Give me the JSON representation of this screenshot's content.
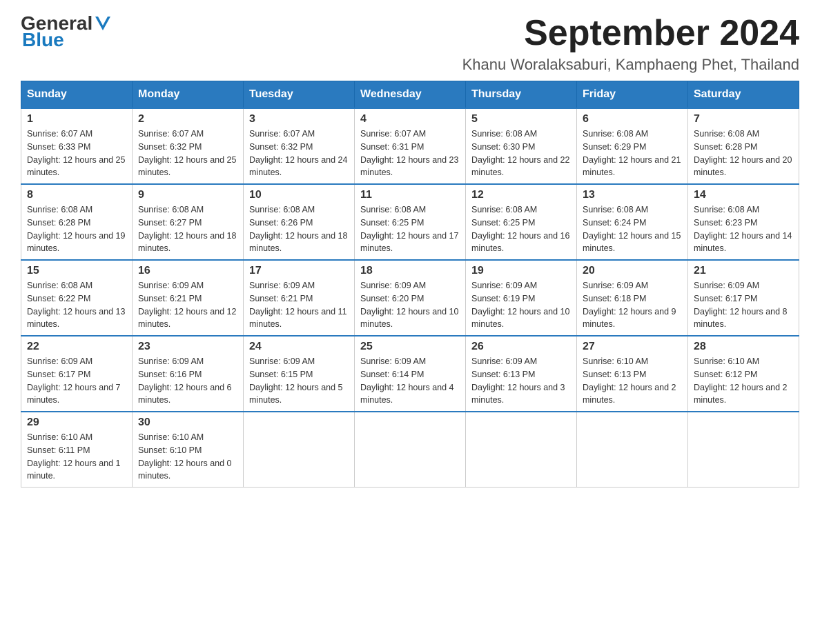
{
  "header": {
    "logo_general": "General",
    "logo_blue": "Blue",
    "month_title": "September 2024",
    "location": "Khanu Woralaksaburi, Kamphaeng Phet, Thailand"
  },
  "days_of_week": [
    "Sunday",
    "Monday",
    "Tuesday",
    "Wednesday",
    "Thursday",
    "Friday",
    "Saturday"
  ],
  "weeks": [
    [
      {
        "day": "1",
        "sunrise": "Sunrise: 6:07 AM",
        "sunset": "Sunset: 6:33 PM",
        "daylight": "Daylight: 12 hours and 25 minutes."
      },
      {
        "day": "2",
        "sunrise": "Sunrise: 6:07 AM",
        "sunset": "Sunset: 6:32 PM",
        "daylight": "Daylight: 12 hours and 25 minutes."
      },
      {
        "day": "3",
        "sunrise": "Sunrise: 6:07 AM",
        "sunset": "Sunset: 6:32 PM",
        "daylight": "Daylight: 12 hours and 24 minutes."
      },
      {
        "day": "4",
        "sunrise": "Sunrise: 6:07 AM",
        "sunset": "Sunset: 6:31 PM",
        "daylight": "Daylight: 12 hours and 23 minutes."
      },
      {
        "day": "5",
        "sunrise": "Sunrise: 6:08 AM",
        "sunset": "Sunset: 6:30 PM",
        "daylight": "Daylight: 12 hours and 22 minutes."
      },
      {
        "day": "6",
        "sunrise": "Sunrise: 6:08 AM",
        "sunset": "Sunset: 6:29 PM",
        "daylight": "Daylight: 12 hours and 21 minutes."
      },
      {
        "day": "7",
        "sunrise": "Sunrise: 6:08 AM",
        "sunset": "Sunset: 6:28 PM",
        "daylight": "Daylight: 12 hours and 20 minutes."
      }
    ],
    [
      {
        "day": "8",
        "sunrise": "Sunrise: 6:08 AM",
        "sunset": "Sunset: 6:28 PM",
        "daylight": "Daylight: 12 hours and 19 minutes."
      },
      {
        "day": "9",
        "sunrise": "Sunrise: 6:08 AM",
        "sunset": "Sunset: 6:27 PM",
        "daylight": "Daylight: 12 hours and 18 minutes."
      },
      {
        "day": "10",
        "sunrise": "Sunrise: 6:08 AM",
        "sunset": "Sunset: 6:26 PM",
        "daylight": "Daylight: 12 hours and 18 minutes."
      },
      {
        "day": "11",
        "sunrise": "Sunrise: 6:08 AM",
        "sunset": "Sunset: 6:25 PM",
        "daylight": "Daylight: 12 hours and 17 minutes."
      },
      {
        "day": "12",
        "sunrise": "Sunrise: 6:08 AM",
        "sunset": "Sunset: 6:25 PM",
        "daylight": "Daylight: 12 hours and 16 minutes."
      },
      {
        "day": "13",
        "sunrise": "Sunrise: 6:08 AM",
        "sunset": "Sunset: 6:24 PM",
        "daylight": "Daylight: 12 hours and 15 minutes."
      },
      {
        "day": "14",
        "sunrise": "Sunrise: 6:08 AM",
        "sunset": "Sunset: 6:23 PM",
        "daylight": "Daylight: 12 hours and 14 minutes."
      }
    ],
    [
      {
        "day": "15",
        "sunrise": "Sunrise: 6:08 AM",
        "sunset": "Sunset: 6:22 PM",
        "daylight": "Daylight: 12 hours and 13 minutes."
      },
      {
        "day": "16",
        "sunrise": "Sunrise: 6:09 AM",
        "sunset": "Sunset: 6:21 PM",
        "daylight": "Daylight: 12 hours and 12 minutes."
      },
      {
        "day": "17",
        "sunrise": "Sunrise: 6:09 AM",
        "sunset": "Sunset: 6:21 PM",
        "daylight": "Daylight: 12 hours and 11 minutes."
      },
      {
        "day": "18",
        "sunrise": "Sunrise: 6:09 AM",
        "sunset": "Sunset: 6:20 PM",
        "daylight": "Daylight: 12 hours and 10 minutes."
      },
      {
        "day": "19",
        "sunrise": "Sunrise: 6:09 AM",
        "sunset": "Sunset: 6:19 PM",
        "daylight": "Daylight: 12 hours and 10 minutes."
      },
      {
        "day": "20",
        "sunrise": "Sunrise: 6:09 AM",
        "sunset": "Sunset: 6:18 PM",
        "daylight": "Daylight: 12 hours and 9 minutes."
      },
      {
        "day": "21",
        "sunrise": "Sunrise: 6:09 AM",
        "sunset": "Sunset: 6:17 PM",
        "daylight": "Daylight: 12 hours and 8 minutes."
      }
    ],
    [
      {
        "day": "22",
        "sunrise": "Sunrise: 6:09 AM",
        "sunset": "Sunset: 6:17 PM",
        "daylight": "Daylight: 12 hours and 7 minutes."
      },
      {
        "day": "23",
        "sunrise": "Sunrise: 6:09 AM",
        "sunset": "Sunset: 6:16 PM",
        "daylight": "Daylight: 12 hours and 6 minutes."
      },
      {
        "day": "24",
        "sunrise": "Sunrise: 6:09 AM",
        "sunset": "Sunset: 6:15 PM",
        "daylight": "Daylight: 12 hours and 5 minutes."
      },
      {
        "day": "25",
        "sunrise": "Sunrise: 6:09 AM",
        "sunset": "Sunset: 6:14 PM",
        "daylight": "Daylight: 12 hours and 4 minutes."
      },
      {
        "day": "26",
        "sunrise": "Sunrise: 6:09 AM",
        "sunset": "Sunset: 6:13 PM",
        "daylight": "Daylight: 12 hours and 3 minutes."
      },
      {
        "day": "27",
        "sunrise": "Sunrise: 6:10 AM",
        "sunset": "Sunset: 6:13 PM",
        "daylight": "Daylight: 12 hours and 2 minutes."
      },
      {
        "day": "28",
        "sunrise": "Sunrise: 6:10 AM",
        "sunset": "Sunset: 6:12 PM",
        "daylight": "Daylight: 12 hours and 2 minutes."
      }
    ],
    [
      {
        "day": "29",
        "sunrise": "Sunrise: 6:10 AM",
        "sunset": "Sunset: 6:11 PM",
        "daylight": "Daylight: 12 hours and 1 minute."
      },
      {
        "day": "30",
        "sunrise": "Sunrise: 6:10 AM",
        "sunset": "Sunset: 6:10 PM",
        "daylight": "Daylight: 12 hours and 0 minutes."
      },
      null,
      null,
      null,
      null,
      null
    ]
  ]
}
